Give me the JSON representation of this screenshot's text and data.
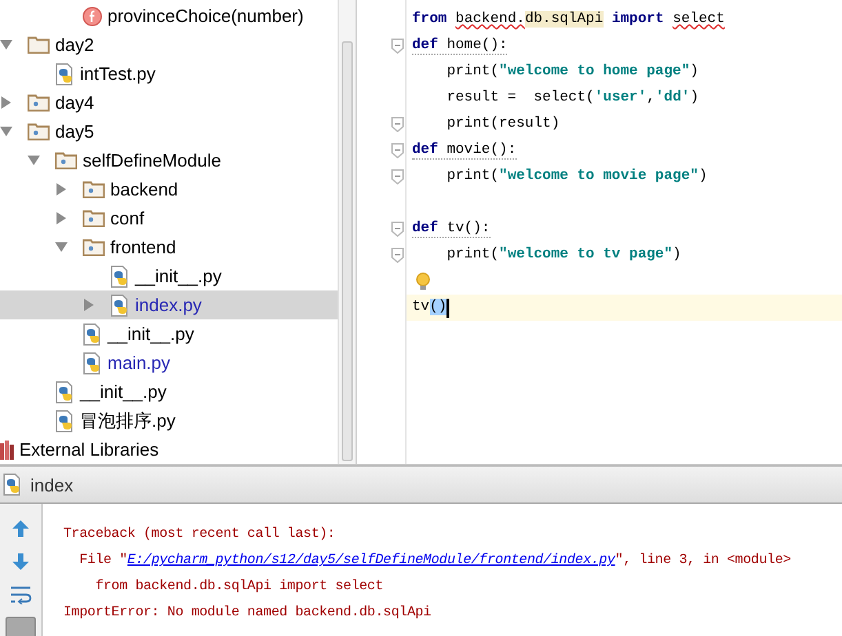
{
  "tree": {
    "top_item": {
      "label": "provinceChoice(number)",
      "kind": "function"
    },
    "items": [
      {
        "label": "day2",
        "kind": "folder",
        "expandable": true,
        "expanded": true,
        "selected": false,
        "modified": false,
        "children": [
          {
            "label": "intTest.py",
            "kind": "python",
            "expandable": false,
            "expanded": false,
            "selected": false,
            "modified": false
          }
        ]
      },
      {
        "label": "day4",
        "kind": "package",
        "expandable": true,
        "expanded": false,
        "selected": false,
        "modified": false
      },
      {
        "label": "day5",
        "kind": "package",
        "expandable": true,
        "expanded": true,
        "selected": false,
        "modified": false,
        "children": [
          {
            "label": "selfDefineModule",
            "kind": "package",
            "expandable": true,
            "expanded": true,
            "selected": false,
            "modified": false,
            "children": [
              {
                "label": "backend",
                "kind": "package",
                "expandable": true,
                "expanded": false,
                "selected": false,
                "modified": false
              },
              {
                "label": "conf",
                "kind": "package",
                "expandable": true,
                "expanded": false,
                "selected": false,
                "modified": false
              },
              {
                "label": "frontend",
                "kind": "package",
                "expandable": true,
                "expanded": true,
                "selected": false,
                "modified": false,
                "children": [
                  {
                    "label": "__init__.py",
                    "kind": "python",
                    "expandable": false,
                    "expanded": false,
                    "selected": false,
                    "modified": false
                  },
                  {
                    "label": "index.py",
                    "kind": "python",
                    "expandable": true,
                    "expanded": false,
                    "selected": true,
                    "modified": true
                  }
                ]
              },
              {
                "label": "__init__.py",
                "kind": "python",
                "expandable": false,
                "expanded": false,
                "selected": false,
                "modified": false
              },
              {
                "label": "main.py",
                "kind": "python",
                "expandable": false,
                "expanded": false,
                "selected": false,
                "modified": true
              }
            ]
          },
          {
            "label": "__init__.py",
            "kind": "python",
            "expandable": false,
            "expanded": false,
            "selected": false,
            "modified": false
          },
          {
            "label": "冒泡排序.py",
            "kind": "python",
            "expandable": false,
            "expanded": false,
            "selected": false,
            "modified": false
          }
        ]
      }
    ],
    "footer_item": {
      "label": "External Libraries"
    }
  },
  "editor": {
    "lines": [
      {
        "fold_marker": false,
        "bulb": false,
        "current": false,
        "pep8_warning": false,
        "tokens": [
          {
            "kind": "keyword",
            "text": "from "
          },
          {
            "kind": "unresolved",
            "text": "backend."
          },
          {
            "kind": "usage",
            "text": "db."
          },
          {
            "kind": "usage",
            "text": "sqlApi"
          },
          {
            "kind": "keyword",
            "text": " import "
          },
          {
            "kind": "unresolved",
            "text": "select"
          }
        ]
      },
      {
        "fold_marker": true,
        "bulb": false,
        "current": false,
        "pep8_warning": true,
        "tokens": [
          {
            "kind": "keyword",
            "text": "def"
          },
          {
            "kind": "plain",
            "text": " home():"
          }
        ]
      },
      {
        "fold_marker": false,
        "bulb": false,
        "current": false,
        "pep8_warning": false,
        "tokens": [
          {
            "kind": "plain",
            "text": "    print("
          },
          {
            "kind": "string",
            "text": "\"welcome to home page\""
          },
          {
            "kind": "plain",
            "text": ")"
          }
        ]
      },
      {
        "fold_marker": false,
        "bulb": false,
        "current": false,
        "pep8_warning": false,
        "tokens": [
          {
            "kind": "plain",
            "text": "    result = "
          },
          {
            "kind": "plain",
            "text": " select("
          },
          {
            "kind": "string",
            "text": "'user'"
          },
          {
            "kind": "plain",
            "text": ","
          },
          {
            "kind": "string",
            "text": "'dd'"
          },
          {
            "kind": "plain",
            "text": ")"
          }
        ]
      },
      {
        "fold_marker": true,
        "bulb": false,
        "current": false,
        "pep8_warning": false,
        "tokens": [
          {
            "kind": "plain",
            "text": "    print(result)"
          }
        ]
      },
      {
        "fold_marker": true,
        "bulb": false,
        "current": false,
        "pep8_warning": true,
        "tokens": [
          {
            "kind": "keyword",
            "text": "def"
          },
          {
            "kind": "plain",
            "text": " movie():"
          }
        ]
      },
      {
        "fold_marker": true,
        "bulb": false,
        "current": false,
        "pep8_warning": false,
        "tokens": [
          {
            "kind": "plain",
            "text": "    print("
          },
          {
            "kind": "string",
            "text": "\"welcome to movie page\""
          },
          {
            "kind": "plain",
            "text": ")"
          }
        ]
      },
      {
        "fold_marker": false,
        "bulb": false,
        "current": false
      },
      {
        "fold_marker": true,
        "bulb": false,
        "current": false,
        "pep8_warning": true,
        "tokens": [
          {
            "kind": "keyword",
            "text": "def"
          },
          {
            "kind": "plain",
            "text": " tv():"
          }
        ]
      },
      {
        "fold_marker": true,
        "bulb": false,
        "current": false,
        "pep8_warning": false,
        "tokens": [
          {
            "kind": "plain",
            "text": "    print("
          },
          {
            "kind": "string",
            "text": "\"welcome to tv page\""
          },
          {
            "kind": "plain",
            "text": ")"
          }
        ]
      },
      {
        "fold_marker": false,
        "bulb": true,
        "current": false
      },
      {
        "fold_marker": false,
        "bulb": false,
        "current": true,
        "pep8_warning": false,
        "tokens": [
          {
            "kind": "plain",
            "text": "tv"
          },
          {
            "kind": "selection",
            "text": "()"
          }
        ]
      }
    ]
  },
  "run_panel": {
    "tab": {
      "label": "index"
    },
    "lines": [
      {
        "segments": [
          {
            "kind": "plain",
            "text": "Traceback (most recent call last):"
          }
        ]
      },
      {
        "segments": [
          {
            "kind": "plain",
            "text": "  File \""
          },
          {
            "kind": "link",
            "text": "E:/pycharm_python/s12/day5/selfDefineModule/frontend/index.py"
          },
          {
            "kind": "plain",
            "text": "\", line 3, in <module>"
          }
        ]
      },
      {
        "segments": [
          {
            "kind": "plain",
            "text": "    from backend.db.sqlApi import select"
          }
        ]
      },
      {
        "segments": [
          {
            "kind": "plain",
            "text": "ImportError: No module named backend.db.sqlApi"
          }
        ]
      }
    ]
  }
}
